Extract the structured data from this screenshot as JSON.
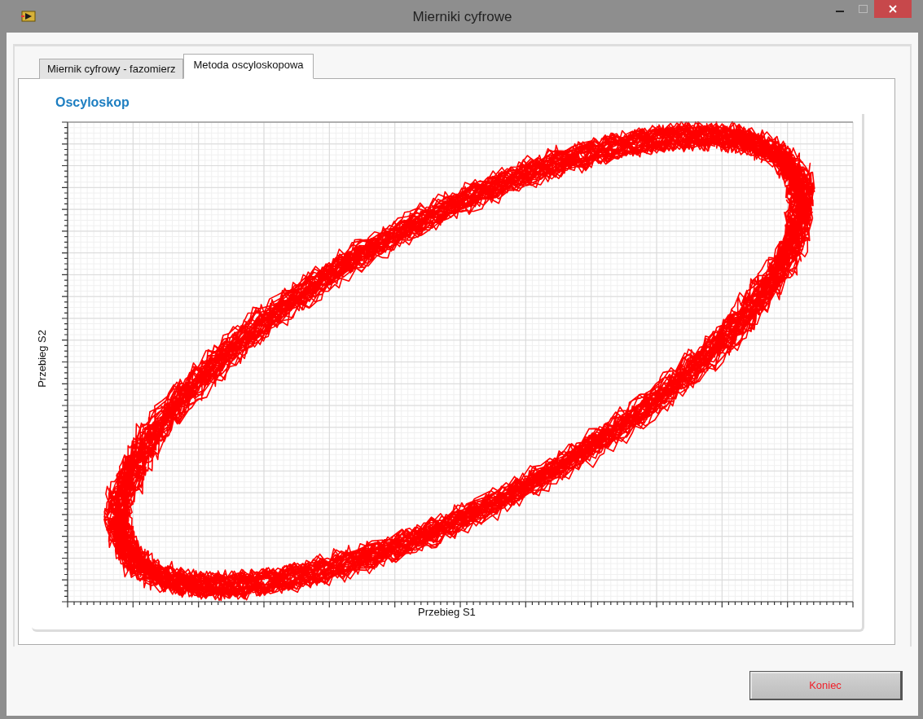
{
  "window": {
    "title": "Mierniki cyfrowe"
  },
  "tabs": [
    {
      "label": "Miernik cyfrowy - fazomierz",
      "selected": false
    },
    {
      "label": "Metoda oscyloskopowa",
      "selected": true
    }
  ],
  "oscilloscope": {
    "title": "Oscyloskop",
    "xlabel": "Przebieg S1",
    "ylabel": "Przebieg S2"
  },
  "buttons": [
    {
      "label": "Koniec"
    }
  ]
}
